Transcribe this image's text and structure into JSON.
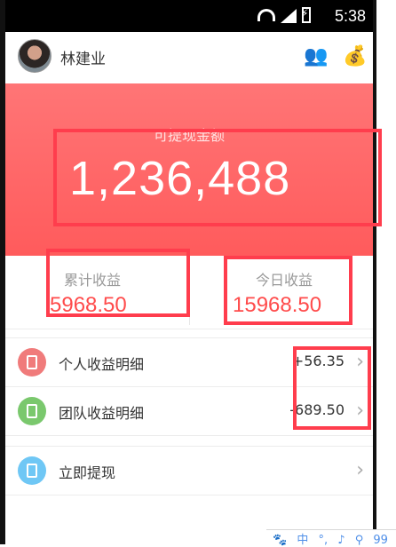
{
  "statusbar": {
    "time": "5:38"
  },
  "header": {
    "username": "林建业"
  },
  "hero": {
    "label": "可提现金额",
    "amount": "1,236,488"
  },
  "stats": [
    {
      "label": "累计收益",
      "value": "5968.50"
    },
    {
      "label": "今日收益",
      "value": "15968.50"
    }
  ],
  "list": [
    {
      "label": "个人收益明细",
      "value": "+56.35",
      "icon_color": "#f07b7b"
    },
    {
      "label": "团队收益明细",
      "value": "-689.50",
      "icon_color": "#7ac86d"
    },
    {
      "label": "立即提现",
      "value": "",
      "icon_color": "#6fc7f5"
    }
  ],
  "taskbar": {
    "items": [
      "中",
      "°,",
      "♪",
      "⚲",
      "99"
    ]
  },
  "colors": {
    "accent": "#ff5b5c",
    "box": "#ff3d4d"
  }
}
